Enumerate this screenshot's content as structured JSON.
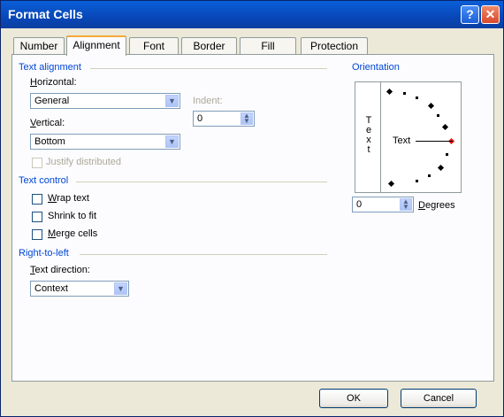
{
  "window": {
    "title": "Format Cells",
    "help_glyph": "?",
    "close_glyph": "✕"
  },
  "tabs": [
    {
      "label": "Number"
    },
    {
      "label": "Alignment",
      "active": true
    },
    {
      "label": "Font"
    },
    {
      "label": "Border"
    },
    {
      "label": "Fill"
    },
    {
      "label": "Protection"
    }
  ],
  "text_alignment": {
    "heading": "Text alignment",
    "horizontal_label": "Horizontal:",
    "horizontal_value": "General",
    "indent_label": "Indent:",
    "indent_value": "0",
    "vertical_label": "Vertical:",
    "vertical_value": "Bottom",
    "justify_distributed_label": "Justify distributed"
  },
  "text_control": {
    "heading": "Text control",
    "wrap_text": "Wrap text",
    "shrink_to_fit": "Shrink to fit",
    "merge_cells": "Merge cells"
  },
  "rtl": {
    "heading": "Right-to-left",
    "direction_label": "Text direction:",
    "direction_value": "Context"
  },
  "orientation": {
    "heading": "Orientation",
    "vertical_letters": [
      "T",
      "e",
      "x",
      "t"
    ],
    "dial_text": "Text",
    "degrees_value": "0",
    "degrees_label": "Degrees"
  },
  "buttons": {
    "ok": "OK",
    "cancel": "Cancel"
  },
  "icons": {
    "dropdown": "chevron-down-icon",
    "spin": "spin-updown-icon"
  },
  "colors": {
    "title_bar": "#0a5fd8",
    "section_heading": "#0046d5",
    "dialog_bg": "#ece9d8",
    "tab_highlight": "#f4a93a"
  }
}
